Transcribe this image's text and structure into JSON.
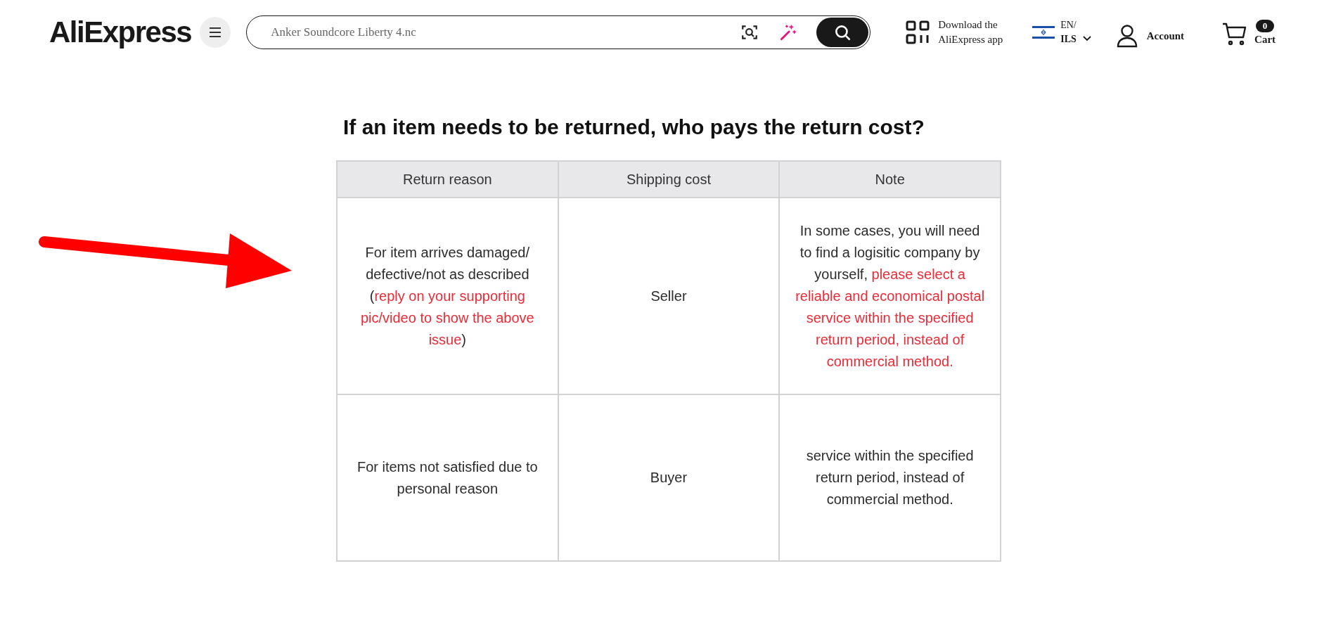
{
  "header": {
    "logo": "AliExpress",
    "search": {
      "value": "Anker Soundcore Liberty 4.nc"
    },
    "app_promo": [
      "Download the",
      "AliExpress app"
    ],
    "language": "EN/",
    "currency": "ILS",
    "account": "Account",
    "cart": {
      "count": "0",
      "label": "Cart"
    }
  },
  "article": {
    "heading": "If an item needs to be returned, who pays the return cost?",
    "table": {
      "columns": [
        "Return reason",
        "Shipping cost",
        "Note"
      ],
      "rows": [
        {
          "cells": [
            [
              {
                "text": "For item arrives damaged/ defective/not as described (",
                "highlight": false
              },
              {
                "text": "reply on your supporting pic/video to show the above issue",
                "highlight": true
              },
              {
                "text": ")",
                "highlight": false
              }
            ],
            [
              {
                "text": "Seller",
                "highlight": false
              }
            ],
            [
              {
                "text": "In some cases, you will need to find a logisitic company by yourself, ",
                "highlight": false
              },
              {
                "text": "please select a reliable and economical postal service within the specified return period, instead of commercial method.",
                "highlight": true
              }
            ]
          ]
        },
        {
          "cells": [
            [
              {
                "text": "For items not satisfied due to personal reason",
                "highlight": false
              }
            ],
            [
              {
                "text": "Buyer",
                "highlight": false
              }
            ],
            [
              {
                "text": "service within the specified return period, instead of commercial method.",
                "highlight": false
              }
            ]
          ]
        }
      ]
    }
  }
}
